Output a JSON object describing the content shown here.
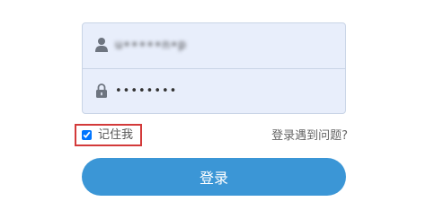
{
  "login": {
    "username": {
      "value": "u•••••n•p",
      "icon": "user-icon"
    },
    "password": {
      "value": "••••••••",
      "icon": "lock-icon"
    },
    "remember": {
      "label": "记住我",
      "checked": true
    },
    "help_link": "登录遇到问题?",
    "submit_label": "登录"
  },
  "colors": {
    "field_background": "#e8eefb",
    "field_border": "#c9d4e6",
    "highlight_border": "#d33a3a",
    "button": "#3b96d6"
  }
}
